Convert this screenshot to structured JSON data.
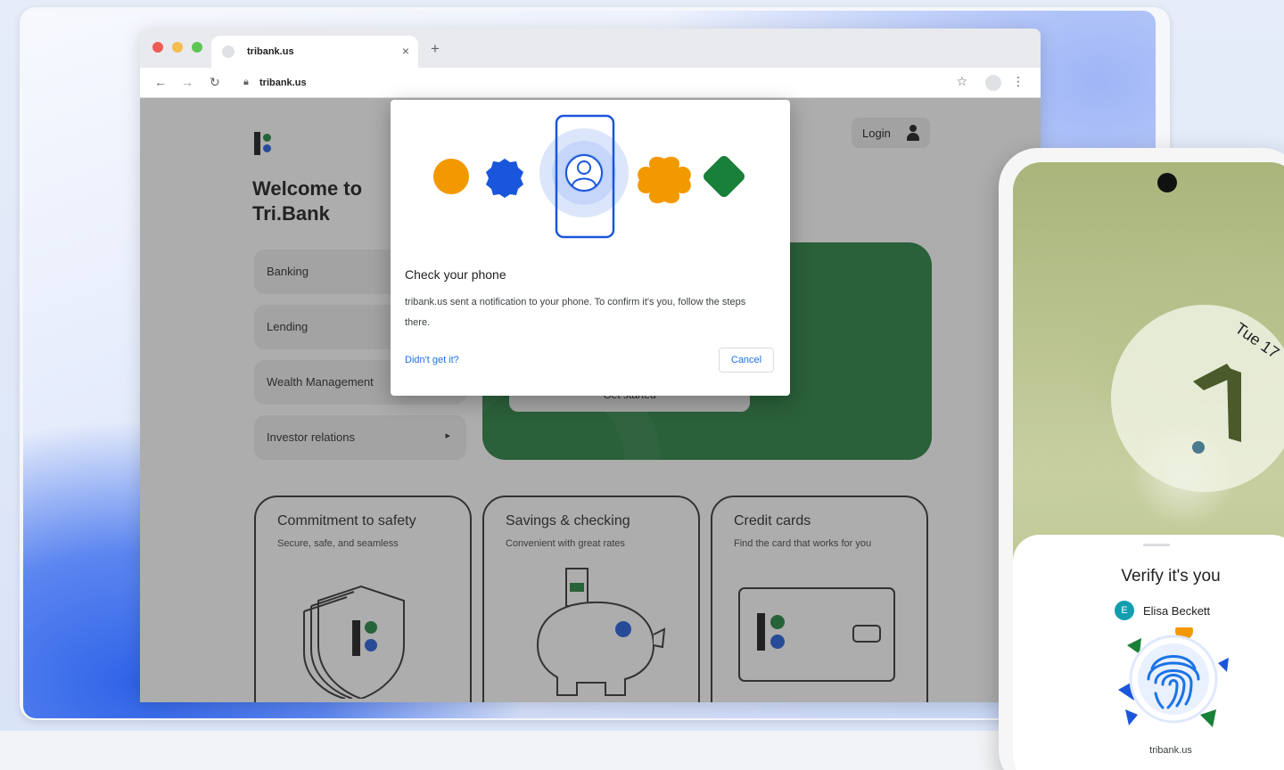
{
  "browser": {
    "tab_title": "tribank.us",
    "tab_close": "×",
    "new_tab": "+",
    "url": "tribank.us"
  },
  "page": {
    "welcome_title": "Welcome to Tri.Bank",
    "login_label": "Login",
    "menu": [
      {
        "label": "Banking"
      },
      {
        "label": "Lending"
      },
      {
        "label": "Wealth Management"
      },
      {
        "label": "Investor relations"
      }
    ],
    "menu_chevron": "▸",
    "hero_button": "Get started",
    "cards": [
      {
        "title": "Commitment to safety",
        "subtitle": "Secure, safe, and seamless"
      },
      {
        "title": "Savings & checking",
        "subtitle": "Convenient with great rates"
      },
      {
        "title": "Credit cards",
        "subtitle": "Find the card that works for you"
      }
    ]
  },
  "dialog": {
    "title": "Check your phone",
    "body": "tribank.us sent a notification to your phone. To confirm it's you, follow the steps there.",
    "link": "Didn't get it?",
    "cancel": "Cancel"
  },
  "phone": {
    "date": "Tue 17",
    "sheet_title": "Verify it's you",
    "account_initial": "E",
    "account_name": "Elisa Beckett",
    "site": "tribank.us"
  },
  "colors": {
    "brand_green": "#1e7b3a",
    "brand_blue": "#1a56db",
    "brand_orange": "#f29900",
    "link_blue": "#1a73e8"
  }
}
